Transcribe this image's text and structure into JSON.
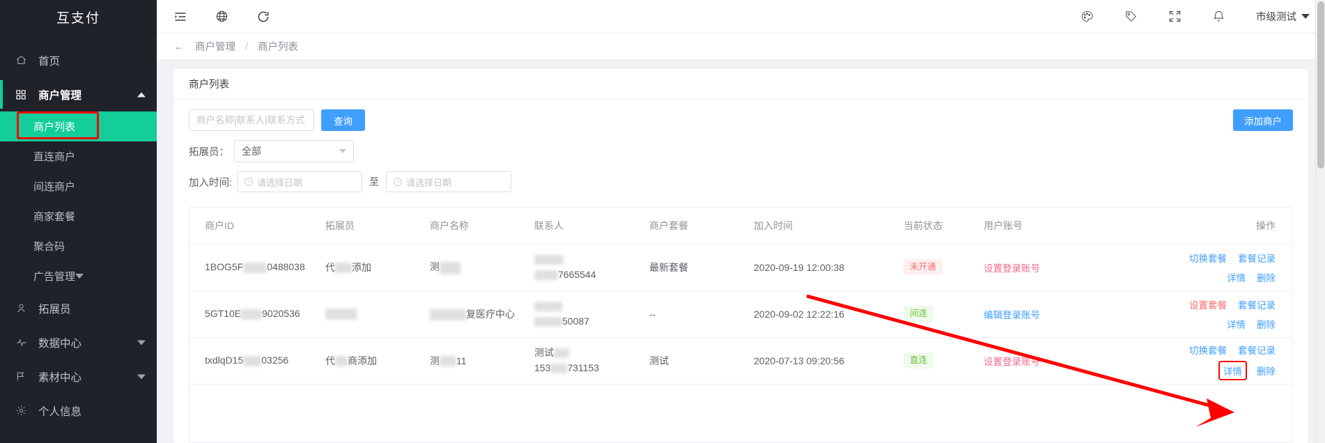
{
  "sidebar": {
    "brand": "互支付",
    "items": [
      {
        "label": "首页",
        "icon": "home-icon",
        "type": "item"
      },
      {
        "label": "商户管理",
        "icon": "grid-icon",
        "type": "group",
        "arrow": "up"
      },
      {
        "label": "商户列表",
        "type": "sub",
        "active": true
      },
      {
        "label": "直连商户",
        "type": "sub"
      },
      {
        "label": "间连商户",
        "type": "sub"
      },
      {
        "label": "商家套餐",
        "type": "sub"
      },
      {
        "label": "聚合码",
        "type": "sub"
      },
      {
        "label": "广告管理",
        "type": "sub",
        "arrow": "down"
      },
      {
        "label": "拓展员",
        "icon": "user-icon",
        "type": "item"
      },
      {
        "label": "数据中心",
        "icon": "pulse-icon",
        "type": "item",
        "arrow": "down"
      },
      {
        "label": "素材中心",
        "icon": "flag-icon",
        "type": "item",
        "arrow": "down"
      },
      {
        "label": "个人信息",
        "icon": "gear-icon",
        "type": "item"
      }
    ]
  },
  "topbar": {
    "icons_left": [
      "menu-fold-icon",
      "globe-icon",
      "refresh-icon"
    ],
    "icons_right": [
      "palette-icon",
      "tag-icon",
      "fullscreen-icon",
      "bell-icon"
    ],
    "user": "市级测试"
  },
  "breadcrumb": {
    "back": "←",
    "parent": "商户管理",
    "separator": "/",
    "current": "商户列表"
  },
  "card": {
    "title": "商户列表",
    "add_button": "添加商户"
  },
  "search": {
    "placeholder": "商户名称|联系人|联系方式",
    "value": "",
    "button": "查询"
  },
  "promoter_filter": {
    "label": "拓展员：",
    "value": "全部"
  },
  "join_time_filter": {
    "label": "加入时间:",
    "start_placeholder": "请选择日期",
    "end_placeholder": "请选择日期",
    "between": "至"
  },
  "table": {
    "columns": [
      "商户ID",
      "拓展员",
      "商户名称",
      "联系人",
      "商户套餐",
      "加入时间",
      "当前状态",
      "用户账号",
      "操作"
    ],
    "rows": [
      {
        "merchant_id_prefix": "1BOG5F",
        "merchant_id_suffix": "0488038",
        "promoter_prefix": "代",
        "promoter_suffix": "添加",
        "merchant_name_prefix": "测",
        "merchant_name_suffix": "",
        "contact_line1": "",
        "contact_line2_suffix": "7665544",
        "package": "最新套餐",
        "join_time": "2020-09-19 12:00:38",
        "status": "未开通",
        "status_color": "red",
        "account_action": "设置登录账号",
        "account_action_color": "pink",
        "actions_row1": [
          "切换套餐",
          "套餐记录"
        ],
        "actions_row2": [
          "详情",
          "删除"
        ],
        "detail_highlighted": false
      },
      {
        "merchant_id_prefix": "5GT10E",
        "merchant_id_suffix": "9020536",
        "promoter_prefix": "",
        "promoter_suffix": "",
        "merchant_name_prefix": "",
        "merchant_name_suffix": "复医疗中心",
        "contact_line1": "",
        "contact_line2_suffix": "50087",
        "package": "--",
        "join_time": "2020-09-02 12:22:16",
        "status": "间连",
        "status_color": "green",
        "account_action": "编辑登录账号",
        "account_action_color": "blue",
        "actions_row1": [
          "设置套餐",
          "套餐记录"
        ],
        "actions_row1_first_color": "red",
        "actions_row2": [
          "详情",
          "删除"
        ],
        "detail_highlighted": false
      },
      {
        "merchant_id_prefix": "txdlqD15",
        "merchant_id_suffix": "03256",
        "promoter_prefix": "代",
        "promoter_suffix": "商添加",
        "merchant_name_prefix": "测",
        "merchant_name_suffix": "11",
        "contact_line1": "测试",
        "contact_line2_suffix": "731153",
        "contact_line2_prefix": "153",
        "package": "测试",
        "join_time": "2020-07-13 09:20:56",
        "status": "直连",
        "status_color": "green",
        "account_action": "设置登录账号",
        "account_action_color": "pink",
        "actions_row1": [
          "切换套餐",
          "套餐记录"
        ],
        "actions_row2": [
          "详情",
          "删除"
        ],
        "detail_highlighted": true
      }
    ]
  },
  "annotations": {
    "arrow_color": "#ff0000",
    "highlight_color": "#ff0000",
    "sidebar_highlight_target": "商户列表",
    "arrow_target": "详情"
  }
}
